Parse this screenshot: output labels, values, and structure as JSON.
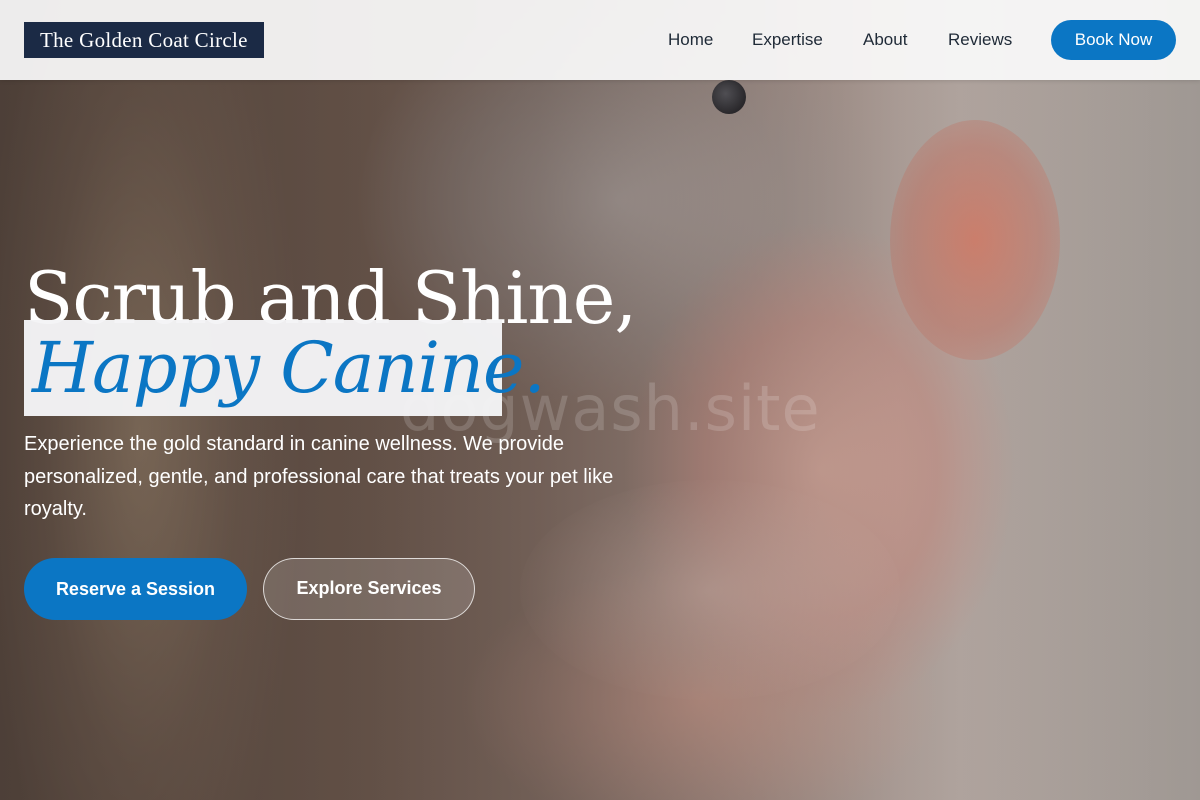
{
  "navbar": {
    "brand": "The Golden Coat Circle",
    "links": [
      "Home",
      "Expertise",
      "About",
      "Reviews"
    ],
    "book_label": "Book Now"
  },
  "hero": {
    "title_line1": "Scrub and Shine,",
    "title_line2": "Happy Canine.",
    "description": "Experience the gold standard in canine wellness. We provide personalized, gentle, and professional care that treats your pet like royalty.",
    "primary_cta": "Reserve a Session",
    "secondary_cta": "Explore Services",
    "watermark": "dogwash.site"
  },
  "colors": {
    "accent": "#0b76c4",
    "brand_bg": "#1b2a45",
    "nav_bg": "#fafafa"
  }
}
